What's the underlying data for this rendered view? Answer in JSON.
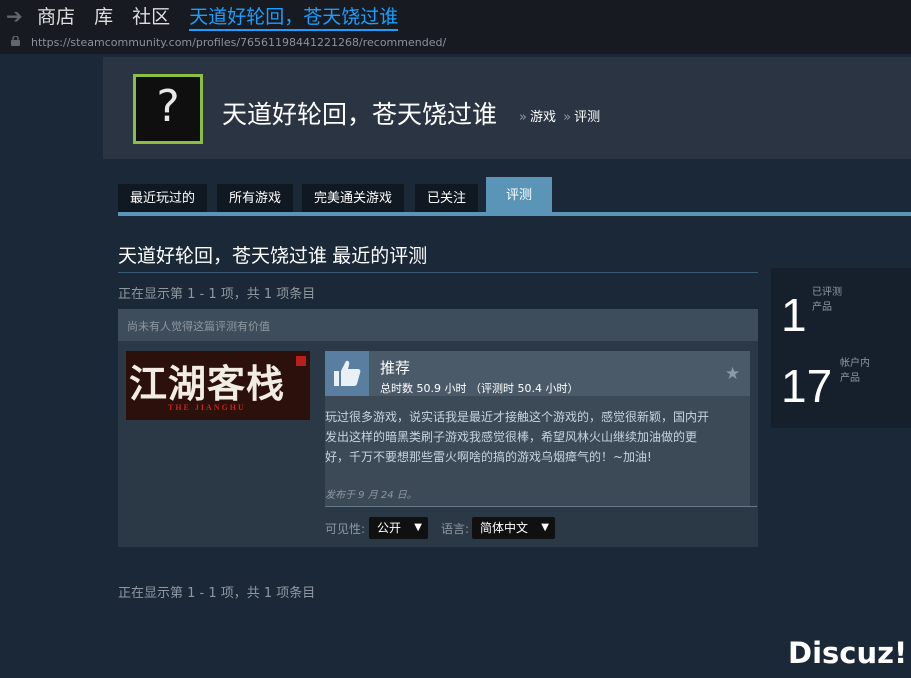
{
  "topnav": {
    "items": [
      "商店",
      "库",
      "社区"
    ],
    "active": "天道好轮回，苍天饶过谁"
  },
  "url": "https://steamcommunity.com/profiles/76561198441221268/recommended/",
  "profile": {
    "avatar_placeholder": "?",
    "name": "天道好轮回，苍天饶过谁",
    "breadcrumb": [
      "游戏",
      "评测"
    ],
    "breadcrumb_sep": "»"
  },
  "tabs": [
    {
      "label": "最近玩过的"
    },
    {
      "label": "所有游戏"
    },
    {
      "label": "完美通关游戏"
    },
    {
      "label": "已关注"
    },
    {
      "label": "评测",
      "active": true
    }
  ],
  "section_title": "天道好轮回，苍天饶过谁 最近的评测",
  "showing_top": "正在显示第 1 - 1 项，共 1 项条目",
  "showing_bottom": "正在显示第 1 - 1 项，共 1 项条目",
  "stats": [
    {
      "number": "1",
      "label": [
        "已评测",
        "产品"
      ]
    },
    {
      "number": "17",
      "label": [
        "帐户内",
        "产品"
      ]
    }
  ],
  "review": {
    "helpful_note": "尚未有人觉得这篇评测有价值",
    "game_logo": "江湖客栈",
    "game_sub": "THE JIANGHU",
    "verdict": "推荐",
    "hours": "总时数 50.9 小时 （评测时 50.4 小时）",
    "body": [
      "玩过很多游戏，说实话我是最近才接触这个游戏的，感觉很新颖，国内开",
      "发出这样的暗黑类刷子游戏我感觉很棒，希望风林火山继续加油做的更",
      "好，千万不要想那些雷火啊啥的搞的游戏乌烟瘴气的！~加油!"
    ],
    "posted": "发布于 9 月 24 日。",
    "visibility_label": "可见性:",
    "visibility_value": "公开",
    "language_label": "语言:",
    "language_value": "简体中文"
  },
  "colors": {
    "background": "#1b2838",
    "accent": "#1a9fff",
    "tab_active": "#5a95b8",
    "avatar_border": "#8dbe3f"
  },
  "watermark": "Discuz!"
}
